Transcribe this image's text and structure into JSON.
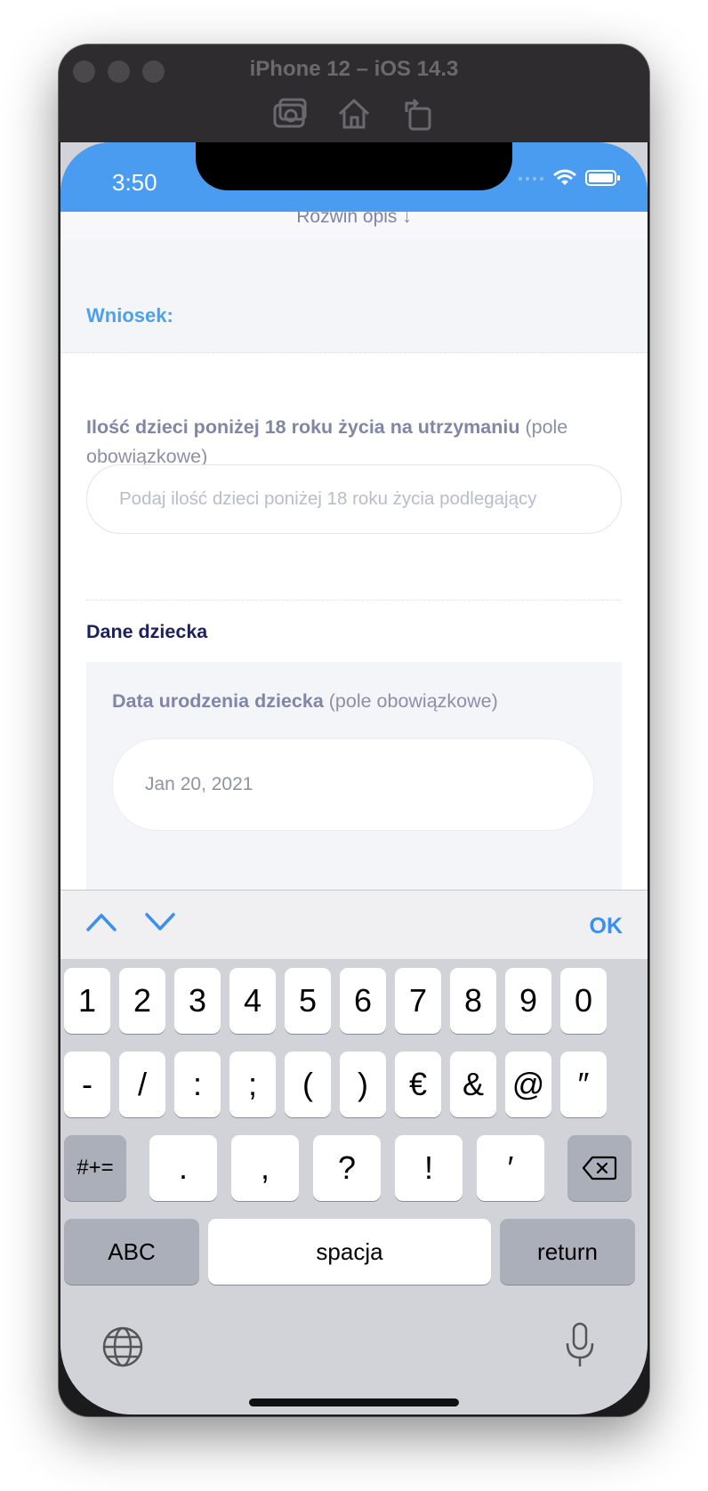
{
  "simulator": {
    "title": "iPhone 12 – iOS 14.3",
    "toolbar_icons": [
      "screenshot-icon",
      "home-icon",
      "rotate-icon"
    ]
  },
  "status_bar": {
    "time": "3:50",
    "icons": [
      "signal-dots-icon",
      "wifi-icon",
      "battery-icon"
    ],
    "color": "#4a9cf0"
  },
  "page": {
    "expand_link": "Rozwiń opis ↓",
    "section_title": "Wniosek:",
    "children_field": {
      "label_bold": "Ilość dzieci poniżej 18 roku życia na utrzymaniu",
      "label_suffix": " (pole obowiązkowe)",
      "placeholder": "Podaj ilość dzieci poniżej 18 roku życia podlegający"
    },
    "child_section_title": "Dane dziecka",
    "birth_field": {
      "label_bold": "Data urodzenia dziecka",
      "label_suffix": " (pole obowiązkowe)",
      "value": "Jan 20, 2021"
    }
  },
  "keyboard": {
    "toolbar_ok": "OK",
    "row1": [
      "1",
      "2",
      "3",
      "4",
      "5",
      "6",
      "7",
      "8",
      "9",
      "0"
    ],
    "row2": [
      "-",
      "/",
      ":",
      ";",
      "(",
      ")",
      "€",
      "&",
      "@",
      "″"
    ],
    "row3": [
      ".",
      ",",
      "?",
      "!",
      "′"
    ],
    "shift_symbols": "#+=",
    "abc": "ABC",
    "space": "spacja",
    "return": "return"
  }
}
